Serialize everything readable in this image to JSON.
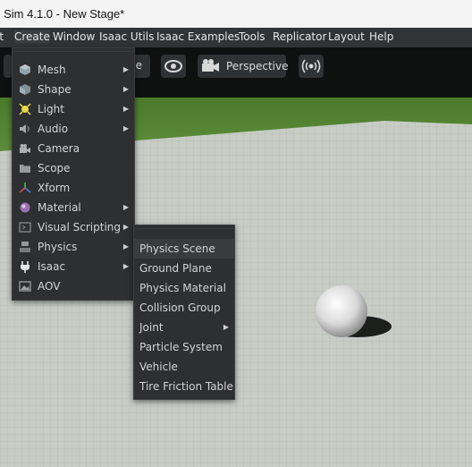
{
  "window": {
    "title": "c Sim 4.1.0 - New Stage*"
  },
  "menubar": {
    "items": [
      "it",
      "Create",
      "Window",
      "Isaac Utils",
      "Isaac Examples",
      "Tools",
      "Replicator",
      "Layout",
      "Help"
    ]
  },
  "toolbar": {
    "partial_label": "ne",
    "camera_label": "Perspective"
  },
  "create_menu": {
    "items": [
      {
        "label": "Mesh",
        "icon": "mesh-icon",
        "submenu": true
      },
      {
        "label": "Shape",
        "icon": "shape-icon",
        "submenu": true
      },
      {
        "label": "Light",
        "icon": "light-icon",
        "submenu": true
      },
      {
        "label": "Audio",
        "icon": "audio-icon",
        "submenu": true
      },
      {
        "label": "Camera",
        "icon": "camera-icon",
        "submenu": false
      },
      {
        "label": "Scope",
        "icon": "folder-icon",
        "submenu": false
      },
      {
        "label": "Xform",
        "icon": "xform-icon",
        "submenu": false
      },
      {
        "label": "Material",
        "icon": "material-icon",
        "submenu": true
      },
      {
        "label": "Visual Scripting",
        "icon": "visual-scripting-icon",
        "submenu": true
      },
      {
        "label": "Physics",
        "icon": "physics-icon",
        "submenu": true
      },
      {
        "label": "Isaac",
        "icon": "isaac-plug-icon",
        "submenu": true
      },
      {
        "label": "AOV",
        "icon": "image-icon",
        "submenu": false
      }
    ]
  },
  "physics_submenu": {
    "items": [
      {
        "label": "Physics Scene",
        "submenu": false,
        "highlighted": true
      },
      {
        "label": "Ground Plane",
        "submenu": false
      },
      {
        "label": "Physics Material",
        "submenu": false
      },
      {
        "label": "Collision Group",
        "submenu": false
      },
      {
        "label": "Joint",
        "submenu": true
      },
      {
        "label": "Particle System",
        "submenu": false
      },
      {
        "label": "Vehicle",
        "submenu": false
      },
      {
        "label": "Tire Friction Table",
        "submenu": false
      }
    ]
  }
}
